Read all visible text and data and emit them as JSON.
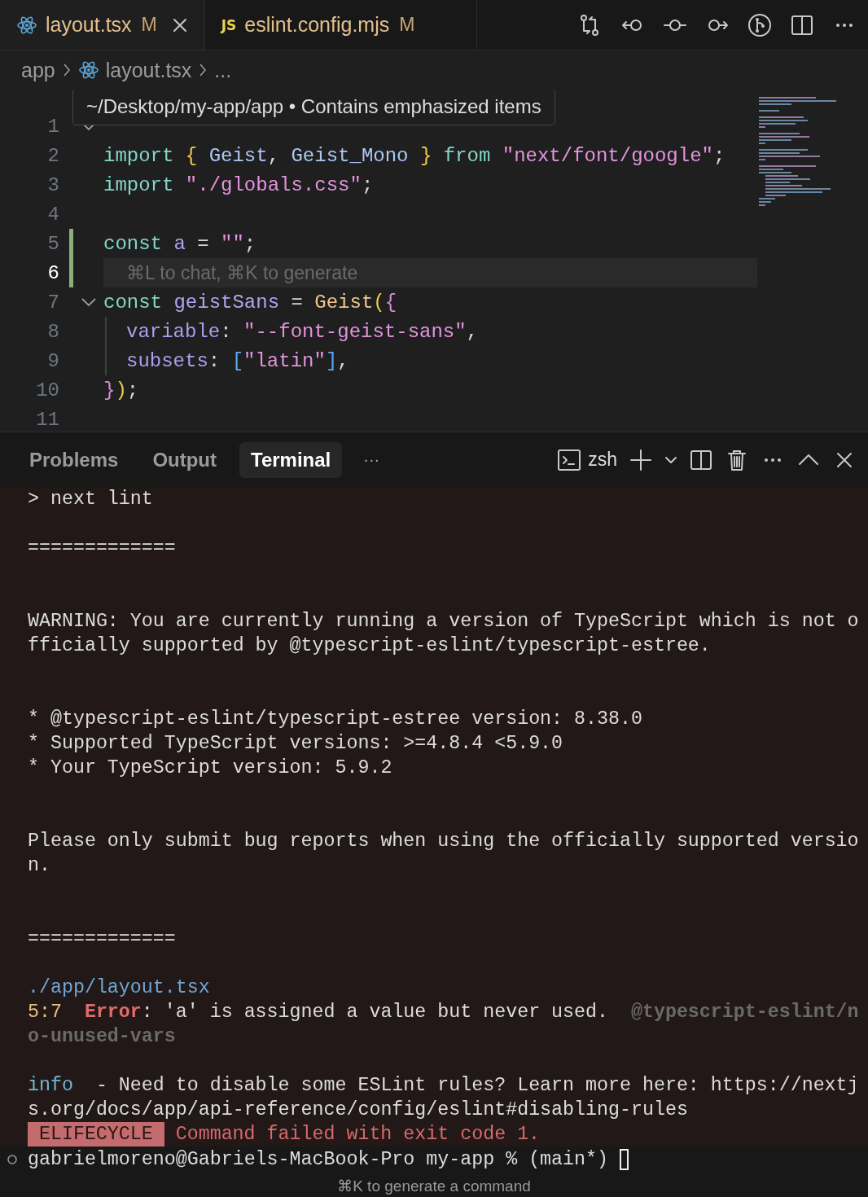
{
  "tabs": [
    {
      "label": "layout.tsx",
      "status": "M",
      "selected": true,
      "closable": true
    },
    {
      "label": "eslint.config.mjs",
      "icon_text": "JS",
      "status": "M",
      "selected": false,
      "closable": false
    }
  ],
  "breadcrumb": [
    "app",
    "layout.tsx",
    "..."
  ],
  "tooltip": "~/Desktop/my-app/app • Contains emphasized items",
  "code_lines": [
    {
      "number": "1",
      "foldable": true,
      "changed": false,
      "current": false,
      "guide": false
    },
    {
      "number": "2",
      "foldable": false,
      "changed": false,
      "current": false,
      "guide": false,
      "segments": [
        {
          "text": "import ",
          "kind": "keyword"
        },
        {
          "text": "{ ",
          "kind": "brace"
        },
        {
          "text": "Geist",
          "kind": "type"
        },
        {
          "text": ", ",
          "kind": "plain"
        },
        {
          "text": "Geist_Mono ",
          "kind": "type"
        },
        {
          "text": "} ",
          "kind": "brace"
        },
        {
          "text": "from ",
          "kind": "keyword"
        },
        {
          "text": "\"next/font/google\"",
          "kind": "string"
        },
        {
          "text": ";",
          "kind": "plain"
        }
      ]
    },
    {
      "number": "3",
      "foldable": false,
      "changed": false,
      "current": false,
      "guide": false,
      "segments": [
        {
          "text": "import ",
          "kind": "keyword"
        },
        {
          "text": "\"./globals.css\"",
          "kind": "string"
        },
        {
          "text": ";",
          "kind": "plain"
        }
      ]
    },
    {
      "number": "4",
      "foldable": false,
      "changed": false,
      "current": false,
      "guide": false
    },
    {
      "number": "5",
      "foldable": false,
      "changed": true,
      "current": false,
      "guide": false,
      "segments": [
        {
          "text": "const ",
          "kind": "keyword"
        },
        {
          "text": "a",
          "kind": "var"
        },
        {
          "text": " = ",
          "kind": "plain"
        },
        {
          "text": "\"\"",
          "kind": "string"
        },
        {
          "text": ";",
          "kind": "plain"
        }
      ]
    },
    {
      "number": "6",
      "foldable": false,
      "changed": true,
      "current": true,
      "guide": false,
      "ghost": "⌘L to chat, ⌘K to generate"
    },
    {
      "number": "7",
      "foldable": true,
      "changed": false,
      "current": false,
      "guide": false,
      "segments": [
        {
          "text": "const ",
          "kind": "keyword"
        },
        {
          "text": "geistSans",
          "kind": "var"
        },
        {
          "text": " = ",
          "kind": "plain"
        },
        {
          "text": "Geist",
          "kind": "func"
        },
        {
          "text": "(",
          "kind": "paren"
        },
        {
          "text": "{",
          "kind": "brace2"
        }
      ]
    },
    {
      "number": "8",
      "foldable": false,
      "changed": false,
      "current": false,
      "guide": true,
      "segments": [
        {
          "text": "variable",
          "kind": "prop"
        },
        {
          "text": ": ",
          "kind": "plain"
        },
        {
          "text": "\"--font-geist-sans\"",
          "kind": "string"
        },
        {
          "text": ",",
          "kind": "plain"
        }
      ]
    },
    {
      "number": "9",
      "foldable": false,
      "changed": false,
      "current": false,
      "guide": true,
      "segments": [
        {
          "text": "subsets",
          "kind": "prop"
        },
        {
          "text": ": ",
          "kind": "plain"
        },
        {
          "text": "[",
          "kind": "bracket"
        },
        {
          "text": "\"latin\"",
          "kind": "string"
        },
        {
          "text": "]",
          "kind": "bracket"
        },
        {
          "text": ",",
          "kind": "plain"
        }
      ]
    },
    {
      "number": "10",
      "foldable": false,
      "changed": false,
      "current": false,
      "guide": false,
      "segments": [
        {
          "text": "}",
          "kind": "brace2"
        },
        {
          "text": ")",
          "kind": "paren"
        },
        {
          "text": ";",
          "kind": "plain"
        }
      ]
    },
    {
      "number": "11",
      "foldable": false,
      "changed": false,
      "current": false,
      "guide": false
    }
  ],
  "panel_tabs": [
    {
      "label": "Problems",
      "selected": false
    },
    {
      "label": "Output",
      "selected": false
    },
    {
      "label": "Terminal",
      "selected": true
    }
  ],
  "panel_more": "···",
  "shell": "zsh",
  "terminal_lines": [
    {
      "kind": "text",
      "segments": [
        {
          "text": "> next lint",
          "kind": "plain"
        }
      ]
    },
    {
      "kind": "blank"
    },
    {
      "kind": "text",
      "segments": [
        {
          "text": "=============",
          "kind": "plain"
        }
      ]
    },
    {
      "kind": "blank"
    },
    {
      "kind": "blank"
    },
    {
      "kind": "text",
      "segments": [
        {
          "text": "WARNING: You are currently running a version of TypeScript which is not o",
          "kind": "plain"
        }
      ]
    },
    {
      "kind": "text",
      "segments": [
        {
          "text": "fficially supported by @typescript-eslint/typescript-estree.",
          "kind": "plain"
        }
      ]
    },
    {
      "kind": "blank"
    },
    {
      "kind": "blank"
    },
    {
      "kind": "text",
      "segments": [
        {
          "text": "* @typescript-eslint/typescript-estree version: 8.38.0",
          "kind": "plain"
        }
      ]
    },
    {
      "kind": "text",
      "segments": [
        {
          "text": "* Supported TypeScript versions: >=4.8.4 <5.9.0",
          "kind": "plain"
        }
      ]
    },
    {
      "kind": "text",
      "segments": [
        {
          "text": "* Your TypeScript version: 5.9.2",
          "kind": "plain"
        }
      ]
    },
    {
      "kind": "blank"
    },
    {
      "kind": "blank"
    },
    {
      "kind": "text",
      "segments": [
        {
          "text": "Please only submit bug reports when using the officially supported versio",
          "kind": "plain"
        }
      ]
    },
    {
      "kind": "text",
      "segments": [
        {
          "text": "n.",
          "kind": "plain"
        }
      ]
    },
    {
      "kind": "blank"
    },
    {
      "kind": "blank"
    },
    {
      "kind": "text",
      "segments": [
        {
          "text": "=============",
          "kind": "plain"
        }
      ]
    },
    {
      "kind": "blank"
    },
    {
      "kind": "text",
      "segments": [
        {
          "text": "./app/layout.tsx",
          "kind": "path"
        }
      ]
    },
    {
      "kind": "text",
      "segments": [
        {
          "text": "5:7",
          "kind": "loc"
        },
        {
          "text": "Error",
          "kind": "error"
        },
        {
          "text": ": 'a' is assigned a value but never used.",
          "kind": "plain"
        },
        {
          "text": "@typescript-eslint/n",
          "kind": "dim"
        }
      ]
    },
    {
      "kind": "text",
      "segments": [
        {
          "text": "o-unused-vars",
          "kind": "dim"
        }
      ]
    },
    {
      "kind": "blank"
    },
    {
      "kind": "text",
      "segments": [
        {
          "text": "info",
          "kind": "info"
        },
        {
          "text": "- Need to disable some ESLint rules? Learn more here: https://nextj",
          "kind": "plain"
        }
      ]
    },
    {
      "kind": "text",
      "segments": [
        {
          "text": "s.org/docs/app/api-reference/config/eslint#disabling-rules",
          "kind": "plain"
        }
      ]
    },
    {
      "kind": "text",
      "segments": [
        {
          "text": "ELIFECYCLE",
          "kind": "badge"
        },
        {
          "text": "Command failed with exit code 1.",
          "kind": "fail"
        }
      ]
    }
  ],
  "prompt": "gabrielmoreno@Gabriels-MacBook-Pro my-app % (main*)",
  "command_hint": "⌘K to generate a command"
}
